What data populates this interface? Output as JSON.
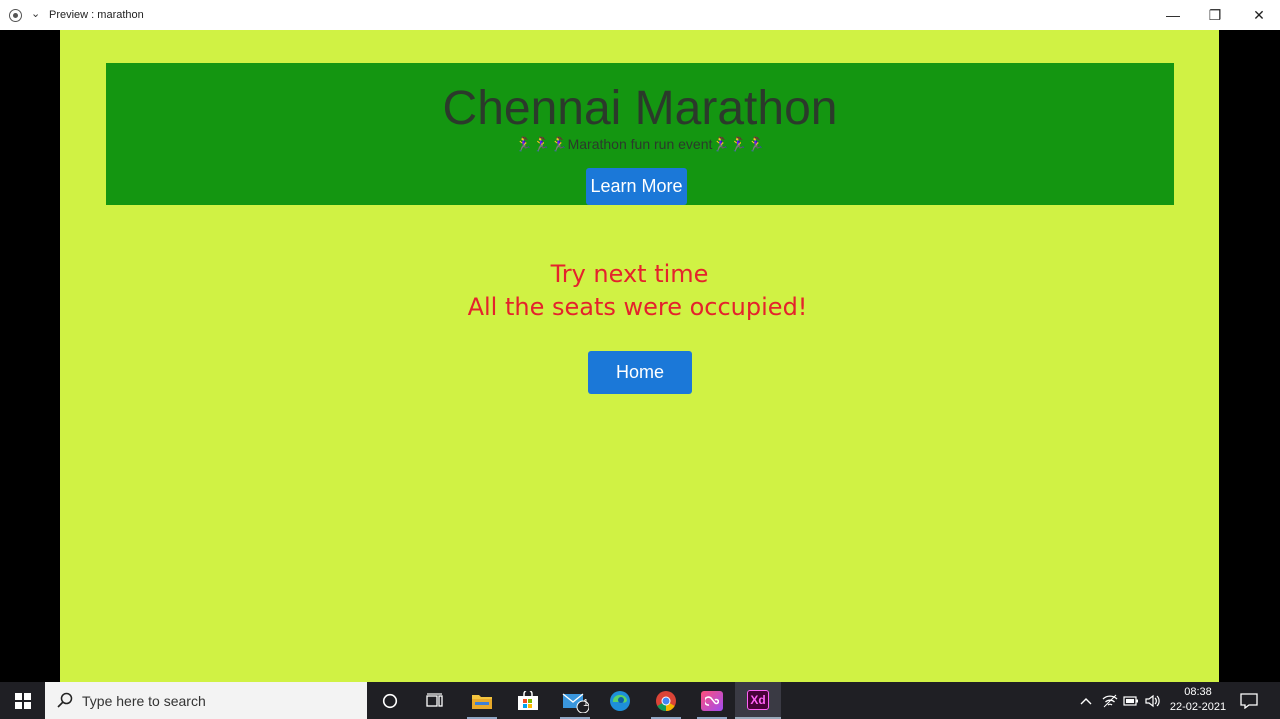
{
  "window": {
    "title": "Preview : marathon",
    "minimize_glyph": "—",
    "maximize_glyph": "❐",
    "close_glyph": "✕"
  },
  "hero": {
    "title": "Chennai Marathon",
    "subtitle": "🏃‍♀️🏃‍♀️🏃‍♀️Marathon fun run event🏃‍♀️🏃‍♀️🏃‍♀️",
    "learn_more_label": "Learn More"
  },
  "message": {
    "line1": "Try next time",
    "line2": "All the seats were occupied!"
  },
  "home_label": "Home",
  "colors": {
    "page_bg": "#d0f244",
    "hero_bg": "#149611",
    "button_bg": "#1b78d8",
    "message_text": "#e4232c"
  },
  "taskbar": {
    "search_placeholder": "Type here to search",
    "mail_badge": "1",
    "time": "08:38",
    "date": "22-02-2021",
    "apps": [
      "cortana-icon",
      "task-view-icon",
      "file-explorer-icon",
      "store-icon",
      "mail-icon",
      "edge-icon",
      "chrome-icon",
      "creative-cloud-icon",
      "adobe-xd-icon"
    ],
    "xd_label": "Xd"
  }
}
